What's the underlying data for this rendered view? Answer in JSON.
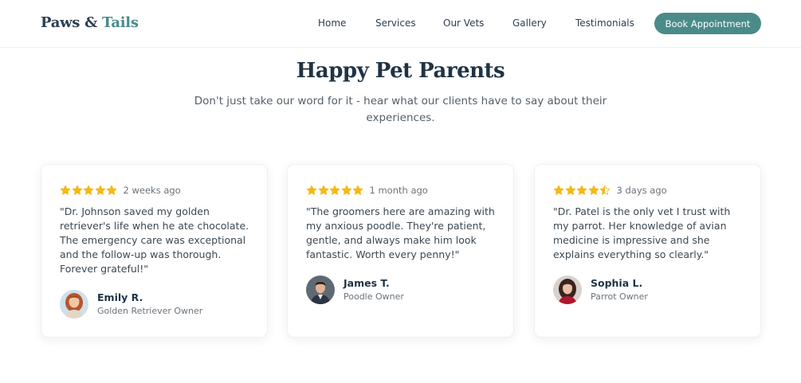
{
  "header": {
    "logo_main": "Paws & ",
    "logo_accent": "Tails",
    "nav": [
      "Home",
      "Services",
      "Our Vets",
      "Gallery",
      "Testimonials"
    ],
    "cta": "Book Appointment"
  },
  "section": {
    "title": "Happy Pet Parents",
    "subtitle": "Don't just take our word for it - hear what our clients have to say about their experiences."
  },
  "colors": {
    "accent": "#4a8b8a",
    "star": "#f5b817",
    "heading": "#1f3344"
  },
  "testimonials": [
    {
      "rating": 5,
      "time": "2 weeks ago",
      "quote": "\"Dr. Johnson saved my golden retriever's life when he ate chocolate. The emergency care was exceptional and the follow-up was thorough. Forever grateful!\"",
      "name": "Emily R.",
      "role": "Golden Retriever Owner",
      "avatar_icon": "avatar-woman-red-hair"
    },
    {
      "rating": 5,
      "time": "1 month ago",
      "quote": "\"The groomers here are amazing with my anxious poodle. They're patient, gentle, and always make him look fantastic. Worth every penny!\"",
      "name": "James T.",
      "role": "Poodle Owner",
      "avatar_icon": "avatar-man-suit"
    },
    {
      "rating": 4.5,
      "time": "3 days ago",
      "quote": "\"Dr. Patel is the only vet I trust with my parrot. Her knowledge of avian medicine is impressive and she explains everything so clearly.\"",
      "name": "Sophia L.",
      "role": "Parrot Owner",
      "avatar_icon": "avatar-woman-dark-hair"
    }
  ]
}
